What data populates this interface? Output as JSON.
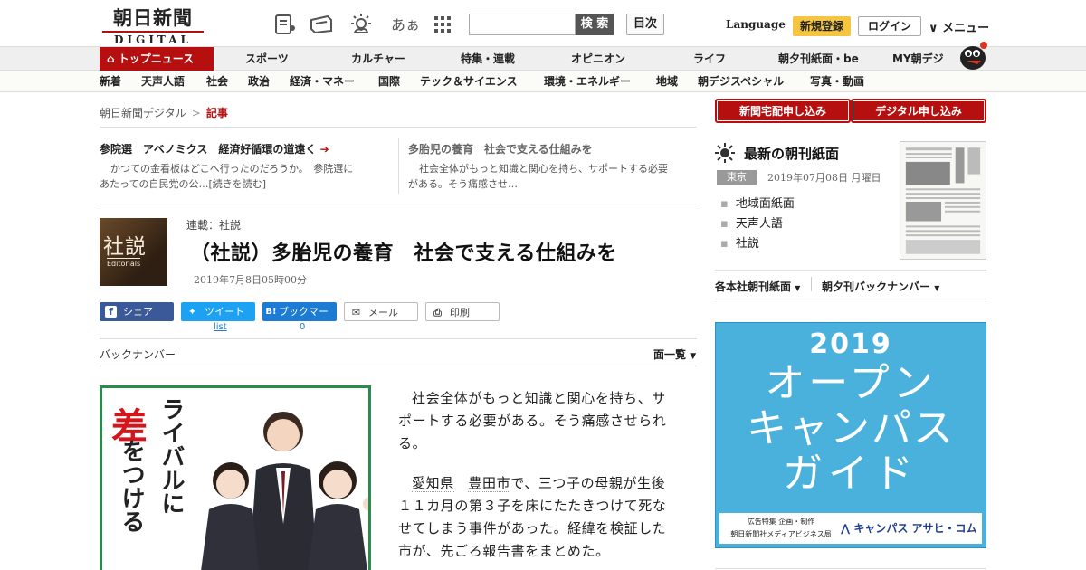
{
  "header": {
    "logo_main": "朝日新聞",
    "logo_sub": "DIGITAL",
    "font_toggle": "あぁ",
    "search_button": "検 索",
    "toc_button": "目次",
    "language": "Language",
    "register": "新規登録",
    "login": "ログイン",
    "menu": "メニュー"
  },
  "nav_primary": [
    "トップニュース",
    "スポーツ",
    "カルチャー",
    "特集・連載",
    "オピニオン",
    "ライフ",
    "朝夕刊紙面・be",
    "MY朝デジ"
  ],
  "nav_secondary": [
    "新着",
    "天声人語",
    "社会",
    "政治",
    "経済・マネー",
    "国際",
    "テック＆サイエンス",
    "環境・エネルギー",
    "地域",
    "朝デジスペシャル",
    "写真・動画"
  ],
  "breadcrumb": [
    "朝日新聞デジタル",
    "記事"
  ],
  "related": [
    {
      "title": "参院選　アベノミクス　経済好循環の道遠く",
      "body_1": "かつての金看板はどこへ行ったのだろうか。　参院選に",
      "body_2": "あたっての自民党の公…[続きを読む]"
    },
    {
      "title": "多胎児の養育　社会で支える仕組みを",
      "body_1": "社会全体がもっと知識と関心を持ち、サポートする必要",
      "body_2": "がある。そう痛感させ…"
    }
  ],
  "article": {
    "thumb_kanji": "社説",
    "thumb_en": "Editorials",
    "series": "連載：社説",
    "headline": "（社説）多胎児の養育　社会で支える仕組みを",
    "date": "2019年7月8日05時00分",
    "share": {
      "facebook": "シェア",
      "twitter": "ツイート",
      "hatena": "ブックマーク",
      "mail": "メール",
      "print": "印刷",
      "twitter_count": "list",
      "hatena_count": "0"
    },
    "backnumber": "バックナンバー",
    "list_all": "面一覧",
    "p1": "社会全体がもっと知識と関心を持ち、サポートする必要がある。そう痛感させられる。",
    "p2_place1": "愛知県",
    "p2_place2": "豊田市",
    "p2_rest": "で、三つ子の母親が生後１１カ月の第３子を床にたたきつけて死なせてしまう事件があった。経緯を検証した市が、先ごろ報告書をまとめた。"
  },
  "ad_left": {
    "line1": "差",
    "line2": "をつける",
    "line3": "ライバルに"
  },
  "sidebar": {
    "apply_home": "新聞宅配申し込み",
    "apply_digital": "デジタル申し込み",
    "paper_title": "最新の朝刊紙面",
    "region": "東京",
    "paper_date": "2019年07月08日 月曜日",
    "links": [
      "地域面紙面",
      "天声人語",
      "社説"
    ],
    "dropdowns": [
      "各本社朝刊紙面",
      "朝夕刊バックナンバー"
    ]
  },
  "ad_right": {
    "year": "2019",
    "line1": "オープン",
    "line2": "キャンパス",
    "line3": "ガイド",
    "foot1": "広告特集 企画・制作",
    "foot2": "朝日新聞社メディアビジネス局",
    "brand": "キャンパス アサヒ・コム"
  },
  "colors": {
    "brand_red": "#b50f0f",
    "register_yellow": "#f5c542",
    "facebook": "#3b5998",
    "twitter": "#1da1f2",
    "hatena": "#1c7bd2",
    "ad_blue": "#4ab1dd"
  }
}
